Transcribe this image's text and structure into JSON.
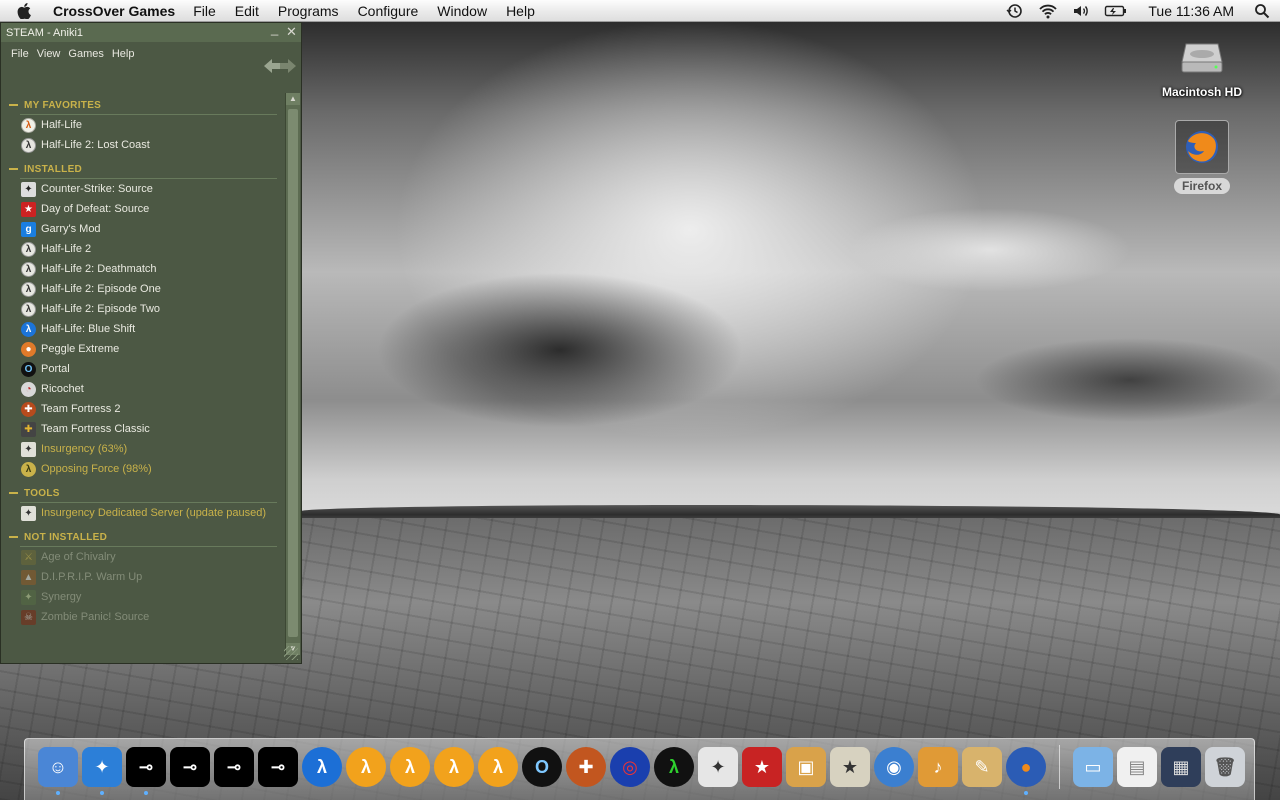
{
  "menubar": {
    "app_name": "CrossOver Games",
    "menus": [
      "File",
      "Edit",
      "Programs",
      "Configure",
      "Window",
      "Help"
    ],
    "clock": "Tue 11:36 AM",
    "status_icons": [
      "time-machine-icon",
      "wifi-icon",
      "volume-icon",
      "battery-icon",
      "spotlight-icon"
    ]
  },
  "steam": {
    "title": "STEAM - Aniki1",
    "menus": [
      "File",
      "View",
      "Games",
      "Help"
    ],
    "sections": [
      {
        "name": "MY FAVORITES",
        "games": [
          {
            "label": "Half-Life",
            "icon": "hl",
            "glyph": "λ",
            "state": "installed"
          },
          {
            "label": "Half-Life 2: Lost Coast",
            "icon": "hl2",
            "glyph": "λ",
            "state": "installed"
          }
        ]
      },
      {
        "name": "INSTALLED",
        "games": [
          {
            "label": "Counter-Strike: Source",
            "icon": "cs",
            "glyph": "✦",
            "state": "installed"
          },
          {
            "label": "Day of Defeat: Source",
            "icon": "dod",
            "glyph": "★",
            "state": "installed"
          },
          {
            "label": "Garry's Mod",
            "icon": "gm",
            "glyph": "g",
            "state": "installed"
          },
          {
            "label": "Half-Life 2",
            "icon": "hl2",
            "glyph": "λ",
            "state": "installed"
          },
          {
            "label": "Half-Life 2: Deathmatch",
            "icon": "hl2",
            "glyph": "λ",
            "state": "installed"
          },
          {
            "label": "Half-Life 2: Episode One",
            "icon": "hl2",
            "glyph": "λ",
            "state": "installed"
          },
          {
            "label": "Half-Life 2: Episode Two",
            "icon": "hl2",
            "glyph": "λ",
            "state": "installed"
          },
          {
            "label": "Half-Life: Blue Shift",
            "icon": "blue",
            "glyph": "λ",
            "state": "installed"
          },
          {
            "label": "Peggle Extreme",
            "icon": "peg",
            "glyph": "●",
            "state": "installed"
          },
          {
            "label": "Portal",
            "icon": "portal",
            "glyph": "O",
            "state": "installed"
          },
          {
            "label": "Ricochet",
            "icon": "rico",
            "glyph": "◔",
            "state": "installed"
          },
          {
            "label": "Team Fortress 2",
            "icon": "tf2",
            "glyph": "✚",
            "state": "installed"
          },
          {
            "label": "Team Fortress Classic",
            "icon": "tfc",
            "glyph": "✚",
            "state": "installed"
          },
          {
            "label": "Insurgency (63%)",
            "icon": "ins",
            "glyph": "✦",
            "state": "installing"
          },
          {
            "label": "Opposing Force (98%)",
            "icon": "of",
            "glyph": "λ",
            "state": "installing"
          }
        ]
      },
      {
        "name": "TOOLS",
        "games": [
          {
            "label": "Insurgency Dedicated Server (update paused)",
            "icon": "ins",
            "glyph": "✦",
            "state": "installing"
          }
        ]
      },
      {
        "name": "NOT INSTALLED",
        "games": [
          {
            "label": "Age of Chivalry",
            "icon": "aoc",
            "glyph": "⚔",
            "state": "uninstalled"
          },
          {
            "label": "D.I.P.R.I.P. Warm Up",
            "icon": "dip",
            "glyph": "▲",
            "state": "uninstalled"
          },
          {
            "label": "Synergy",
            "icon": "syn",
            "glyph": "✦",
            "state": "uninstalled"
          },
          {
            "label": "Zombie Panic! Source",
            "icon": "zps",
            "glyph": "☠",
            "state": "uninstalled"
          }
        ]
      }
    ]
  },
  "desktop": {
    "icons": [
      {
        "label": "Macintosh HD",
        "icon": "hard-drive-icon",
        "selected": false
      },
      {
        "label": "Firefox",
        "icon": "firefox-icon",
        "selected": true
      }
    ]
  },
  "dock": {
    "apps": [
      {
        "name": "finder",
        "glyph": "☺",
        "bg": "#4a86d6",
        "fg": "#fff",
        "running": true
      },
      {
        "name": "safari",
        "glyph": "✦",
        "bg": "#2c7fd8",
        "fg": "#fff",
        "running": true
      },
      {
        "name": "steam-1",
        "glyph": "⊸",
        "bg": "#000",
        "fg": "#fff",
        "running": true
      },
      {
        "name": "steam-2",
        "glyph": "⊸",
        "bg": "#000",
        "fg": "#fff",
        "running": false
      },
      {
        "name": "steam-3",
        "glyph": "⊸",
        "bg": "#000",
        "fg": "#fff",
        "running": false
      },
      {
        "name": "steam-4",
        "glyph": "⊸",
        "bg": "#000",
        "fg": "#fff",
        "running": false
      },
      {
        "name": "half-life-blue",
        "glyph": "λ",
        "bg": "#1c6fd6",
        "fg": "#fff",
        "running": false
      },
      {
        "name": "half-life-2-a",
        "glyph": "λ",
        "bg": "#f2a21c",
        "fg": "#fff",
        "running": false
      },
      {
        "name": "half-life-2-b",
        "glyph": "λ",
        "bg": "#f2a21c",
        "fg": "#fff",
        "running": false
      },
      {
        "name": "half-life-2-c",
        "glyph": "λ",
        "bg": "#f2a21c",
        "fg": "#fff",
        "running": false
      },
      {
        "name": "half-life-2-d",
        "glyph": "λ",
        "bg": "#f2a21c",
        "fg": "#fff",
        "running": false
      },
      {
        "name": "portal",
        "glyph": "O",
        "bg": "#111",
        "fg": "#7ec8ff",
        "running": false
      },
      {
        "name": "team-fortress-2",
        "glyph": "✚",
        "bg": "#c2561f",
        "fg": "#fff",
        "running": false
      },
      {
        "name": "peggle",
        "glyph": "◎",
        "bg": "#1a3fae",
        "fg": "#e33",
        "running": false
      },
      {
        "name": "half-life-green",
        "glyph": "λ",
        "bg": "#111",
        "fg": "#2ed12e",
        "running": false
      },
      {
        "name": "counter-strike",
        "glyph": "✦",
        "bg": "#e6e6e6",
        "fg": "#333",
        "running": false
      },
      {
        "name": "day-of-defeat",
        "glyph": "★",
        "bg": "#c82323",
        "fg": "#fff",
        "running": false
      },
      {
        "name": "iphoto",
        "glyph": "▣",
        "bg": "#d9a24a",
        "fg": "#fff",
        "running": false
      },
      {
        "name": "imovie",
        "glyph": "★",
        "bg": "#d7d2c0",
        "fg": "#333",
        "running": false
      },
      {
        "name": "idvd",
        "glyph": "◉",
        "bg": "#3b7fd0",
        "fg": "#fff",
        "running": false
      },
      {
        "name": "garageband",
        "glyph": "♪",
        "bg": "#e09a36",
        "fg": "#fff",
        "running": false
      },
      {
        "name": "iweb",
        "glyph": "✎",
        "bg": "#d8b36c",
        "fg": "#fff",
        "running": false
      },
      {
        "name": "firefox",
        "glyph": "●",
        "bg": "#2b5cb5",
        "fg": "#f08a1a",
        "running": true
      }
    ],
    "stacks": [
      {
        "name": "applications-folder",
        "glyph": "▭",
        "bg": "#7cb3e6",
        "fg": "#fff"
      },
      {
        "name": "documents",
        "glyph": "▤",
        "bg": "#f0f0f0",
        "fg": "#888"
      },
      {
        "name": "downloads",
        "glyph": "▦",
        "bg": "#2f3e5a",
        "fg": "#ddd"
      },
      {
        "name": "trash",
        "glyph": "🗑",
        "bg": "#cfd3d8",
        "fg": "#555"
      }
    ]
  }
}
